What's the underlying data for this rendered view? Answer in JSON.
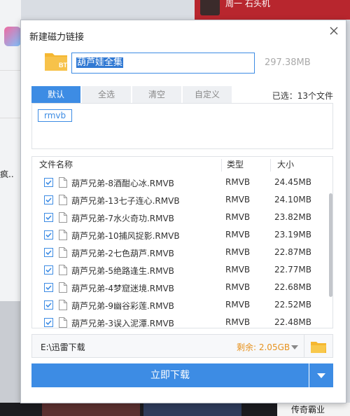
{
  "background": {
    "left_word": "疯..",
    "top_right_text": "周一  石头机",
    "bottom_right_text": "传奇霸业"
  },
  "dialog": {
    "title": "新建磁力链接",
    "name_value": "葫芦娃全集",
    "total_size": "297.38MB",
    "tabs": [
      {
        "label": "默认",
        "active": true
      },
      {
        "label": "全选",
        "active": false
      },
      {
        "label": "清空",
        "active": false
      },
      {
        "label": "自定义",
        "active": false
      }
    ],
    "selected_count": "已选：13个文件",
    "type_filters": [
      "rmvb"
    ],
    "columns": {
      "name": "文件名称",
      "type": "类型",
      "size": "大小"
    },
    "files": [
      {
        "name": "葫芦兄弟-8酒酣心冰.RMVB",
        "type": "RMVB",
        "size": "24.45MB",
        "checked": true
      },
      {
        "name": "葫芦兄弟-13七子连心.RMVB",
        "type": "RMVB",
        "size": "24.10MB",
        "checked": true
      },
      {
        "name": "葫芦兄弟-7水火奇功.RMVB",
        "type": "RMVB",
        "size": "23.82MB",
        "checked": true
      },
      {
        "name": "葫芦兄弟-10捕风捉影.RMVB",
        "type": "RMVB",
        "size": "23.19MB",
        "checked": true
      },
      {
        "name": "葫芦兄弟-2七色葫芦.RMVB",
        "type": "RMVB",
        "size": "22.87MB",
        "checked": true
      },
      {
        "name": "葫芦兄弟-5绝路逢生.RMVB",
        "type": "RMVB",
        "size": "22.77MB",
        "checked": true
      },
      {
        "name": "葫芦兄弟-4梦窟迷境.RMVB",
        "type": "RMVB",
        "size": "22.68MB",
        "checked": true
      },
      {
        "name": "葫芦兄弟-9幽谷彩莲.RMVB",
        "type": "RMVB",
        "size": "22.52MB",
        "checked": true
      },
      {
        "name": "葫芦兄弟-3误入泥潭.RMVB",
        "type": "RMVB",
        "size": "22.48MB",
        "checked": true
      }
    ],
    "save_path": "E:\\迅雷下载",
    "free_space": "剩余: 2.05GB",
    "download_label": "立即下载"
  },
  "colors": {
    "accent": "#3d8ce4",
    "warning": "#e7921e",
    "folder": "#f5b731"
  },
  "icons": {
    "folder": "folder-bt-icon",
    "close": "close-icon",
    "file": "file-icon",
    "browse": "open-folder-icon",
    "dropdown": "chevron-down-icon"
  }
}
